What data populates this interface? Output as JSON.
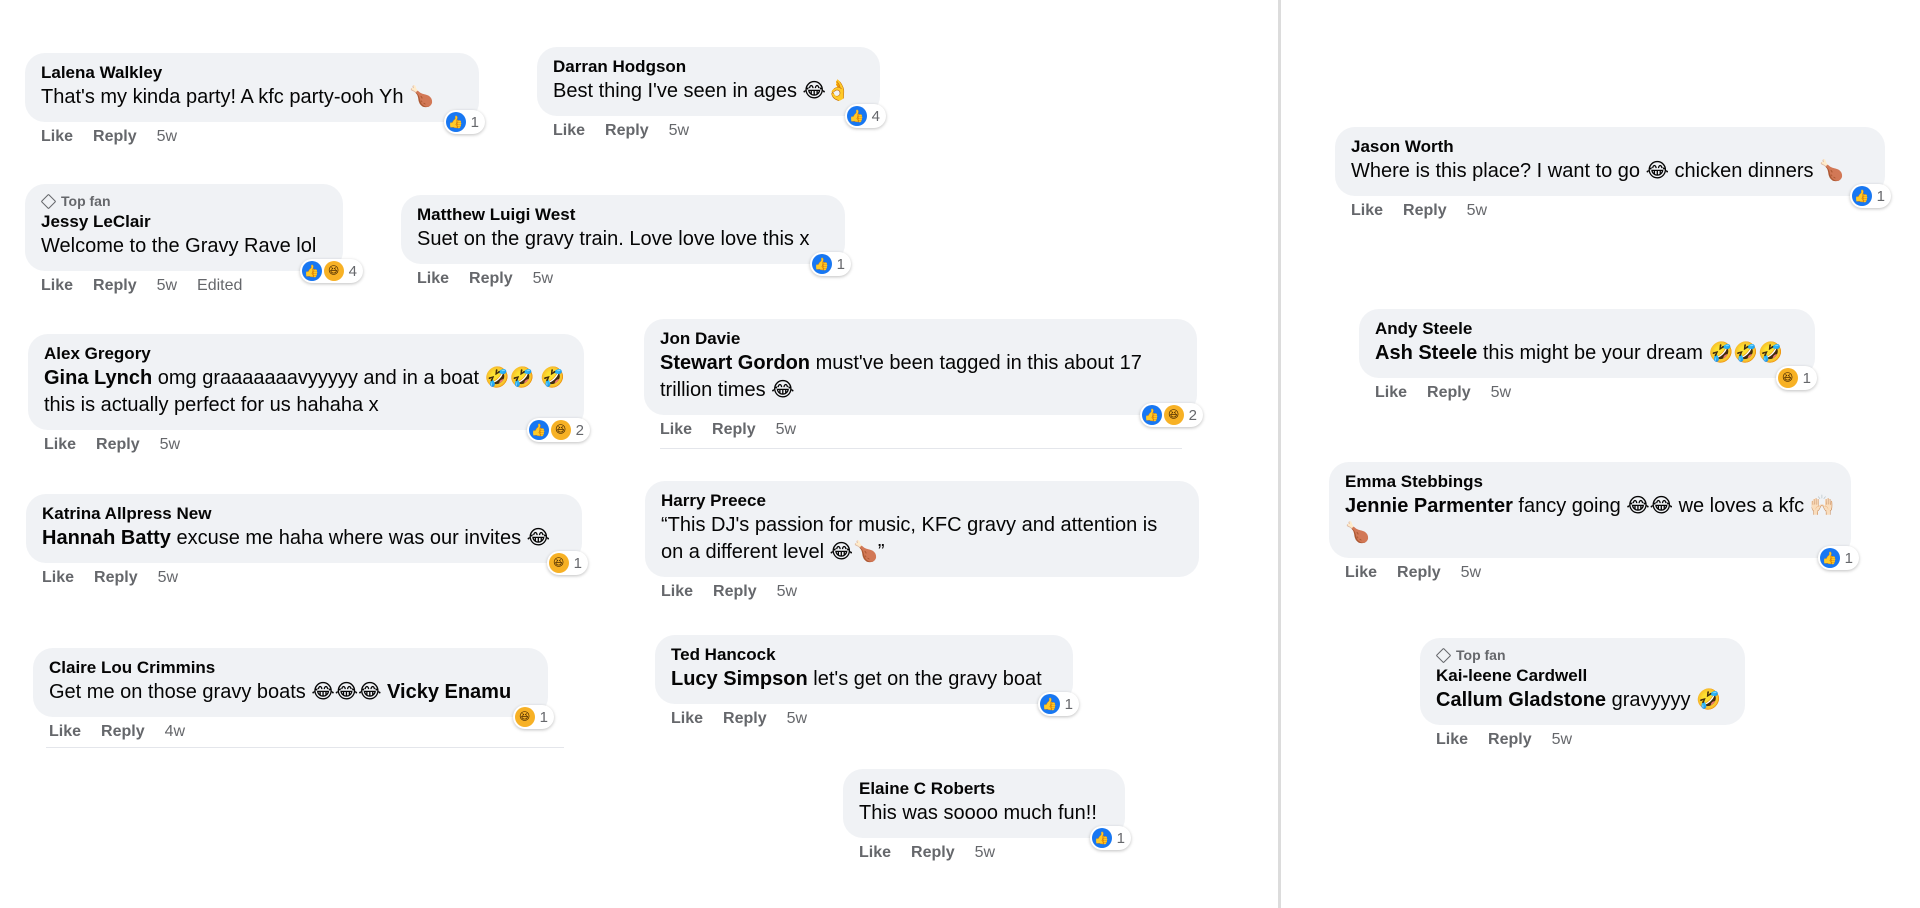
{
  "comments": [
    {
      "author": "Lalena Walkley",
      "text": "That's my kinda party! A kfc party-ooh Yh 🍗",
      "actions": {
        "like": "Like",
        "reply": "Reply",
        "time": "5w"
      },
      "reactions": {
        "count": "1"
      }
    },
    {
      "author": "Darran Hodgson",
      "text": "Best thing I've seen in ages 😂👌",
      "actions": {
        "like": "Like",
        "reply": "Reply",
        "time": "5w"
      },
      "reactions": {
        "count": "4"
      }
    },
    {
      "badge": "Top fan",
      "author": "Jessy LeClair",
      "text": "Welcome to the Gravy Rave lol",
      "actions": {
        "like": "Like",
        "reply": "Reply",
        "time": "5w",
        "edited": "Edited"
      },
      "reactions": {
        "count": "4"
      }
    },
    {
      "author": "Matthew Luigi West",
      "text": "Suet on the gravy train. Love love love this x",
      "actions": {
        "like": "Like",
        "reply": "Reply",
        "time": "5w"
      },
      "reactions": {
        "count": "1"
      }
    },
    {
      "author": "Alex Gregory",
      "tag": "Gina Lynch",
      "text": " omg graaaaaaavyyyyy and in a boat 🤣🤣 🤣 this is actually perfect for us hahaha x",
      "actions": {
        "like": "Like",
        "reply": "Reply",
        "time": "5w"
      },
      "reactions": {
        "count": "2"
      }
    },
    {
      "author": "Jon Davie",
      "tag": "Stewart Gordon",
      "text": " must've been tagged in this about 17 trillion times 😂",
      "actions": {
        "like": "Like",
        "reply": "Reply",
        "time": "5w"
      },
      "reactions": {
        "count": "2"
      }
    },
    {
      "author": "Katrina Allpress New",
      "tag": "Hannah Batty",
      "text": " excuse me haha where was our invites 😂",
      "actions": {
        "like": "Like",
        "reply": "Reply",
        "time": "5w"
      },
      "reactions": {
        "count": "1"
      }
    },
    {
      "author": "Harry Preece",
      "text": "“This DJ's passion for music, KFC gravy and attention is on a different level 😂🍗”",
      "actions": {
        "like": "Like",
        "reply": "Reply",
        "time": "5w"
      }
    },
    {
      "author": "Claire Lou Crimmins",
      "text": "Get me on those gravy boats 😂😂😂 ",
      "tag_after": "Vicky Enamu",
      "actions": {
        "like": "Like",
        "reply": "Reply",
        "time": "4w"
      },
      "reactions": {
        "count": "1"
      }
    },
    {
      "author": "Ted Hancock",
      "tag": "Lucy Simpson",
      "text": " let's get on the gravy boat",
      "actions": {
        "like": "Like",
        "reply": "Reply",
        "time": "5w"
      },
      "reactions": {
        "count": "1"
      }
    },
    {
      "author": "Elaine C Roberts",
      "text": "This was soooo much fun!!",
      "actions": {
        "like": "Like",
        "reply": "Reply",
        "time": "5w"
      },
      "reactions": {
        "count": "1"
      }
    },
    {
      "author": "Jason Worth",
      "text": "Where is this place? I want to go 😂 chicken dinners 🍗",
      "actions": {
        "like": "Like",
        "reply": "Reply",
        "time": "5w"
      },
      "reactions": {
        "count": "1"
      }
    },
    {
      "author": "Andy Steele",
      "tag": "Ash Steele",
      "text": " this might be your dream 🤣🤣🤣",
      "actions": {
        "like": "Like",
        "reply": "Reply",
        "time": "5w"
      },
      "reactions": {
        "count": "1"
      }
    },
    {
      "author": "Emma Stebbings",
      "tag": "Jennie Parmenter",
      "text": " fancy going 😂😂 we loves a kfc 🙌🏻 🍗",
      "actions": {
        "like": "Like",
        "reply": "Reply",
        "time": "5w"
      },
      "reactions": {
        "count": "1"
      }
    },
    {
      "badge": "Top fan",
      "author": "Kai-leene Cardwell",
      "tag": "Callum Gladstone",
      "text": " gravyyyy 🤣",
      "actions": {
        "like": "Like",
        "reply": "Reply",
        "time": "5w"
      }
    }
  ],
  "icons": {
    "like": "thumbs-up-icon",
    "haha": "laughing-face-icon",
    "badge": "diamond-badge-icon"
  },
  "colors": {
    "like": "#1877f2",
    "haha": "#f7b125",
    "bubble": "#f0f2f5",
    "meta": "#65676b"
  }
}
